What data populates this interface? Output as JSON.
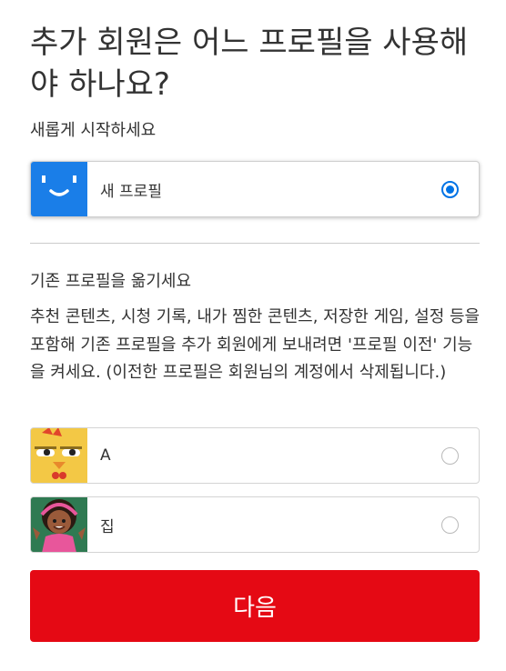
{
  "header": {
    "title": "추가 회원은 어느 프로필을 사용해야 하나요?"
  },
  "new_profile_section": {
    "label": "새롭게 시작하세요",
    "card": {
      "name": "새 프로필",
      "avatar_icon": "smiley-face-avatar-icon",
      "avatar_color": "#1a7ee8",
      "selected": true
    }
  },
  "transfer_section": {
    "label": "기존 프로필을 옮기세요",
    "description": "추천 콘텐츠, 시청 기록, 내가 찜한 콘텐츠, 저장한 게임, 설정 등을 포함해 기존 프로필을 추가 회원에게 보내려면 '프로필 이전' 기능을 켜세요. (이전한 프로필은 회원님의 계정에서 삭제됩니다.)",
    "profiles": [
      {
        "name": "A",
        "avatar_icon": "chicken-avatar-icon",
        "selected": false
      },
      {
        "name": "집",
        "avatar_icon": "girl-avatar-icon",
        "selected": false
      }
    ]
  },
  "footer": {
    "next_label": "다음"
  },
  "colors": {
    "accent_button": "#e50914",
    "radio_selected": "#0073e6"
  }
}
